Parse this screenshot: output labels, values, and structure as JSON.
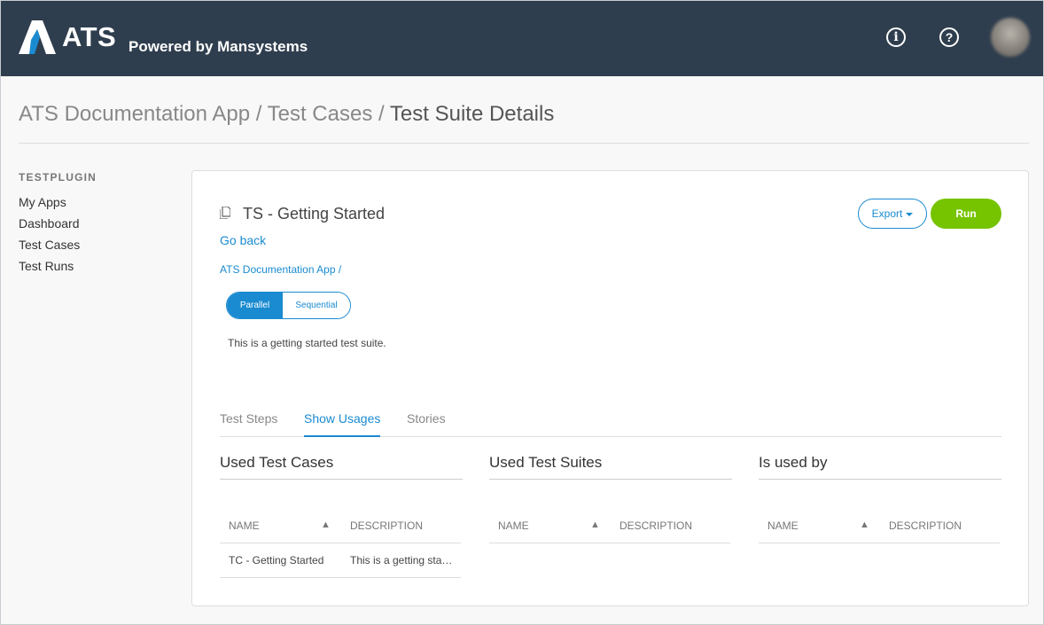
{
  "header": {
    "brand": "ATS",
    "tagline": "Powered by Mansystems",
    "info_icon": "info-icon",
    "help_icon": "help-icon",
    "colors": {
      "bar": "#2f3e4e",
      "logo": "#1a8bd0"
    }
  },
  "breadcrumb": {
    "app": "ATS Documentation App",
    "sep1": " / ",
    "section": "Test Cases",
    "sep2": " / ",
    "current": "Test Suite Details"
  },
  "sidebar": {
    "title": "TESTPLUGIN",
    "items": [
      {
        "label": "My Apps"
      },
      {
        "label": "Dashboard"
      },
      {
        "label": "Test Cases"
      },
      {
        "label": "Test Runs"
      }
    ]
  },
  "suite": {
    "icon": "document-icon",
    "title": "TS - Getting Started",
    "go_back": "Go back",
    "app_link": "ATS Documentation App",
    "app_link_sep": "/",
    "mode_options": [
      "Parallel",
      "Sequential"
    ],
    "mode_selected": "Parallel",
    "description": "This is a getting started test suite."
  },
  "actions": {
    "export_label": "Export",
    "run_label": "Run",
    "colors": {
      "accent": "#1a8bd0",
      "run": "#76c300"
    }
  },
  "tabs": [
    {
      "label": "Test Steps",
      "active": false
    },
    {
      "label": "Show Usages",
      "active": true
    },
    {
      "label": "Stories",
      "active": false
    }
  ],
  "sections": [
    {
      "title": "Used Test Cases",
      "columns": [
        "NAME",
        "DESCRIPTION"
      ],
      "sort_indicator": "▲",
      "rows": [
        {
          "name": "TC - Getting Started",
          "description": "This is a getting started test case."
        }
      ]
    },
    {
      "title": "Used Test Suites",
      "columns": [
        "NAME",
        "DESCRIPTION"
      ],
      "sort_indicator": "▲",
      "rows": []
    },
    {
      "title": "Is used by",
      "columns": [
        "NAME",
        "DESCRIPTION"
      ],
      "sort_indicator": "▲",
      "rows": []
    }
  ]
}
